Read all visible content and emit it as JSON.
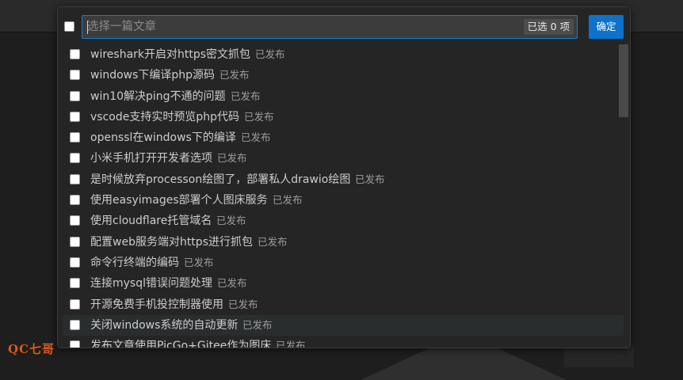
{
  "input": {
    "placeholder": "选择一篇文章",
    "value": ""
  },
  "selection_count": "已选 0 项",
  "ok_label": "确定",
  "status_label": "已发布",
  "items": [
    {
      "title": "wireshark开启对https密文抓包",
      "status": "已发布"
    },
    {
      "title": "windows下编译php源码",
      "status": "已发布"
    },
    {
      "title": "win10解决ping不通的问题",
      "status": "已发布"
    },
    {
      "title": "vscode支持实时预览php代码",
      "status": "已发布"
    },
    {
      "title": "openssl在windows下的编译",
      "status": "已发布"
    },
    {
      "title": "小米手机打开开发者选项",
      "status": "已发布"
    },
    {
      "title": "是时候放弃processon绘图了，部署私人drawio绘图",
      "status": "已发布"
    },
    {
      "title": "使用easyimages部署个人图床服务",
      "status": "已发布"
    },
    {
      "title": "使用cloudflare托管域名",
      "status": "已发布"
    },
    {
      "title": "配置web服务端对https进行抓包",
      "status": "已发布"
    },
    {
      "title": "命令行终端的编码",
      "status": "已发布"
    },
    {
      "title": "连接mysql错误问题处理",
      "status": "已发布"
    },
    {
      "title": "开源免费手机投控制器使用",
      "status": "已发布"
    },
    {
      "title": "关闭windows系统的自动更新",
      "status": "已发布"
    },
    {
      "title": "发布文章使用PicGo+Gitee作为图床",
      "status": "已发布"
    }
  ],
  "hover_index": 13,
  "watermark": "QC七哥"
}
